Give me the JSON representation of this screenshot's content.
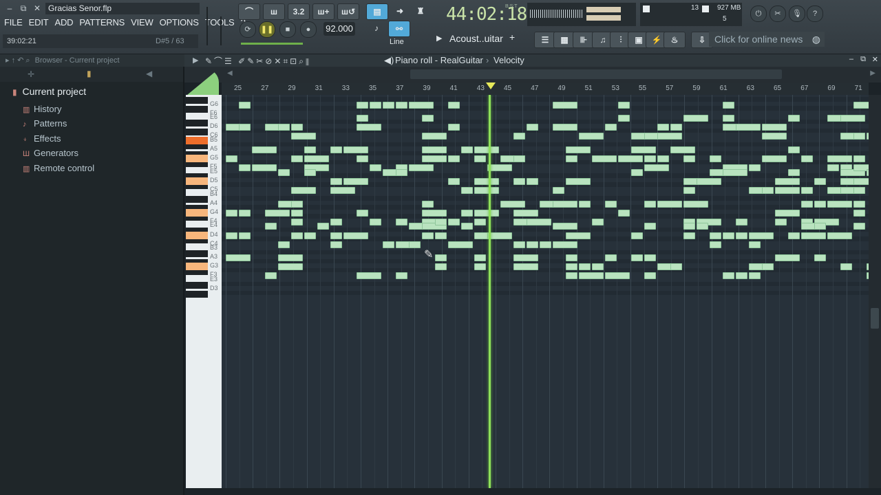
{
  "window": {
    "file_title": "Gracias Senor.flp"
  },
  "menu": [
    "FILE",
    "EDIT",
    "ADD",
    "PATTERNS",
    "VIEW",
    "OPTIONS",
    "TOOLS",
    "?"
  ],
  "hint": {
    "left": "39:02:21",
    "right": "D#5 / 63"
  },
  "transport": {
    "time": "44:02:18",
    "time_unit": "B:S:T",
    "tempo": "92.000",
    "mode": "Line",
    "pattern": "Acoust..uitar",
    "pattern_add": "+",
    "shortcut_label": "3.2"
  },
  "monitor": {
    "cpu": "13",
    "memory": "927 MB",
    "polyphony": "5"
  },
  "news": {
    "label": "Click for online news"
  },
  "browser": {
    "header": "Browser - Current project",
    "title": "Current project",
    "items": [
      {
        "label": "History",
        "icon": "clock-icon"
      },
      {
        "label": "Patterns",
        "icon": "note-icon"
      },
      {
        "label": "Effects",
        "icon": "plug-icon"
      },
      {
        "label": "Generators",
        "icon": "generator-icon"
      },
      {
        "label": "Remote control",
        "icon": "remote-icon"
      }
    ]
  },
  "piano_roll": {
    "title": "Piano roll - RealGuitar",
    "target": "Velocity",
    "bars": [
      "25",
      "27",
      "29",
      "31",
      "33",
      "35",
      "37",
      "39",
      "41",
      "43",
      "45",
      "47",
      "49",
      "51",
      "53",
      "55",
      "57",
      "59",
      "61",
      "63",
      "65",
      "67",
      "69",
      "71"
    ],
    "key_labels": [
      "G6",
      "F6",
      "E6",
      "D6",
      "C6",
      "B5",
      "A5",
      "G5",
      "F5",
      "E5",
      "D5",
      "C5",
      "B4",
      "A4",
      "G4",
      "F4",
      "E4",
      "D4",
      "C4",
      "B3",
      "A3",
      "G3",
      "F3",
      "E3",
      "D3"
    ],
    "highlighted_key": "A5",
    "scale_keys": [
      "G5",
      "D5",
      "G4",
      "D4",
      "G3"
    ],
    "playhead_bar": 44
  }
}
